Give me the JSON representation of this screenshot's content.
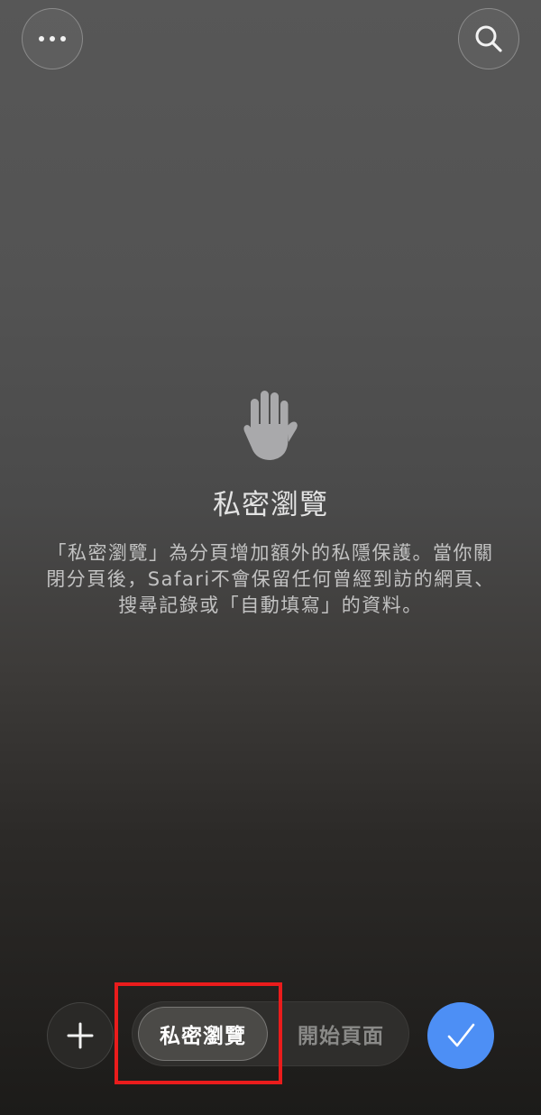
{
  "header": {
    "more_icon": "ellipsis-icon",
    "search_icon": "magnifier-icon"
  },
  "empty_state": {
    "icon": "hand-raised-icon",
    "title": "私密瀏覽",
    "description_lines": [
      "「私密瀏覽」為分頁增加額外的私隱保護。當你關",
      "閉分頁後，Safari不會保留任何曾經到訪的網頁、",
      "搜尋記錄或「自動填寫」的資料。"
    ]
  },
  "toolbar": {
    "add_icon": "plus-icon",
    "segments": [
      {
        "label": "私密瀏覽",
        "selected": true
      },
      {
        "label": "開始頁面",
        "selected": false
      }
    ],
    "done_icon": "checkmark-icon",
    "accent_color": "#4d8ff5"
  },
  "annotation": {
    "highlight_color": "#ea1c1c"
  }
}
